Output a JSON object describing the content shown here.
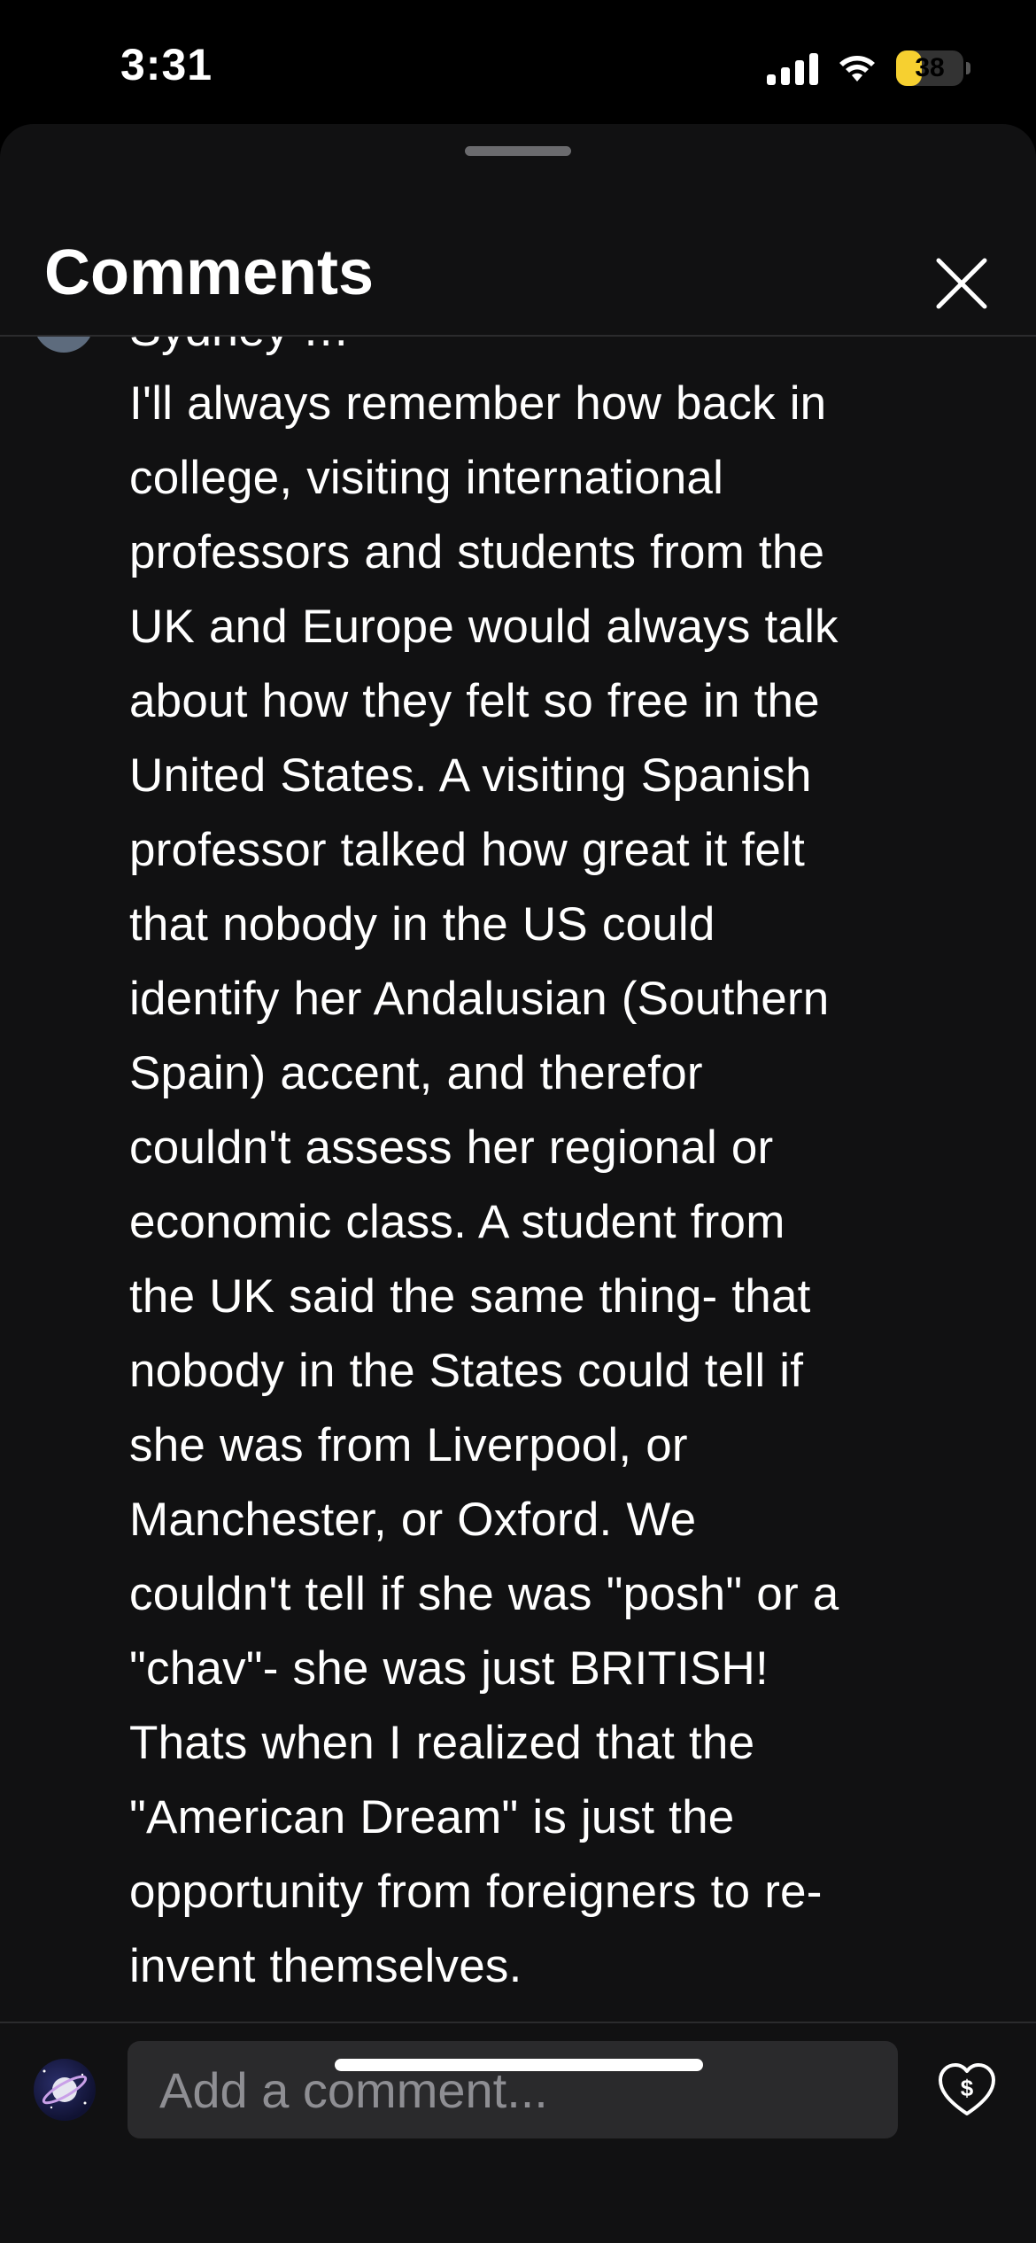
{
  "status_bar": {
    "time": "3:31",
    "battery_level": "38",
    "icons": [
      "signal-icon",
      "wifi-icon",
      "battery-icon"
    ],
    "battery_color": "#f6d030"
  },
  "sheet": {
    "title": "Comments",
    "close_icon": "close-icon"
  },
  "comment": {
    "author_line_partial": "Sydney …",
    "lines": [
      "I'll always remember how back in",
      "college, visiting international",
      "professors and students from the",
      "UK and Europe would always talk",
      "about how they felt so free in the",
      "United States. A visiting Spanish",
      "professor talked how great it felt",
      "that nobody in the US could",
      "identify her Andalusian (Southern",
      "Spain) accent, and therefor",
      "couldn't assess her regional or",
      "economic class. A student from",
      "the UK said the same thing- that",
      "nobody in the States could tell if",
      "she was from Liverpool, or",
      "Manchester, or Oxford. We",
      "couldn't tell if she was \"posh\" or a",
      "\"chav\"- she was just BRITISH!",
      "Thats when I realized that the",
      "\"American Dream\" is just the",
      "opportunity from foreigners to re-",
      "invent themselves."
    ]
  },
  "composer": {
    "placeholder": "Add a comment...",
    "avatar_icon": "planet-avatar-icon",
    "tip_icon": "heart-dollar-icon"
  }
}
